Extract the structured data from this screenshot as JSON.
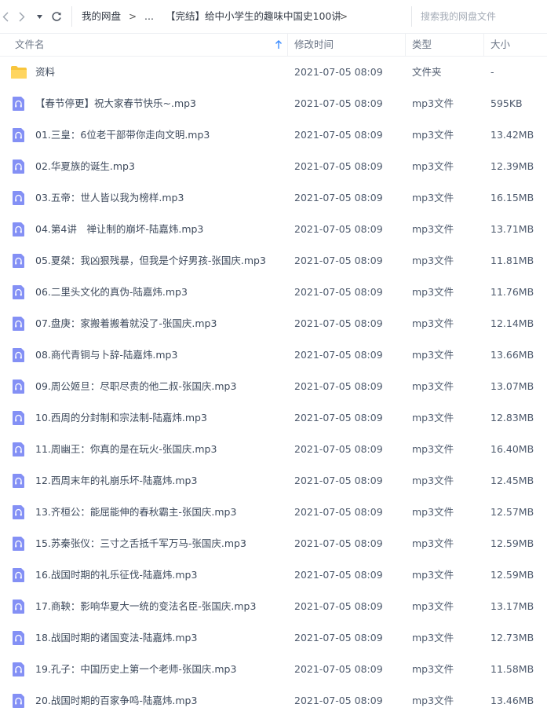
{
  "breadcrumb": {
    "root": "我的网盘",
    "ellipsis": "...",
    "current": "【完结】给中小学生的趣味中国史100讲",
    "arrow": ">"
  },
  "search": {
    "placeholder": "搜索我的网盘文件"
  },
  "columns": {
    "name": "文件名",
    "time": "修改时间",
    "type": "类型",
    "size": "大小"
  },
  "colors": {
    "folder": "#f8c53c",
    "audio_icon_bg": "#8490f5",
    "accent": "#3b8cff"
  },
  "files": [
    {
      "icon": "folder-icon",
      "name": "资料",
      "time": "2021-07-05 08:09",
      "type": "文件夹",
      "size": "-"
    },
    {
      "icon": "audio-file-icon",
      "name": "【春节停更】祝大家春节快乐~.mp3",
      "time": "2021-07-05 08:09",
      "type": "mp3文件",
      "size": "595KB"
    },
    {
      "icon": "audio-file-icon",
      "name": "01.三皇：6位老干部带你走向文明.mp3",
      "time": "2021-07-05 08:09",
      "type": "mp3文件",
      "size": "13.42MB"
    },
    {
      "icon": "audio-file-icon",
      "name": "02.华夏族的诞生.mp3",
      "time": "2021-07-05 08:09",
      "type": "mp3文件",
      "size": "12.39MB"
    },
    {
      "icon": "audio-file-icon",
      "name": "03.五帝：世人皆以我为榜样.mp3",
      "time": "2021-07-05 08:09",
      "type": "mp3文件",
      "size": "16.15MB"
    },
    {
      "icon": "audio-file-icon",
      "name": "04.第4讲　禅让制的崩坏-陆嘉炜.mp3",
      "time": "2021-07-05 08:09",
      "type": "mp3文件",
      "size": "13.71MB"
    },
    {
      "icon": "audio-file-icon",
      "name": "05.夏桀：我凶狠残暴，但我是个好男孩-张国庆.mp3",
      "time": "2021-07-05 08:09",
      "type": "mp3文件",
      "size": "11.81MB"
    },
    {
      "icon": "audio-file-icon",
      "name": "06.二里头文化的真伪-陆嘉炜.mp3",
      "time": "2021-07-05 08:09",
      "type": "mp3文件",
      "size": "11.76MB"
    },
    {
      "icon": "audio-file-icon",
      "name": "07.盘庚：家搬着搬着就没了-张国庆.mp3",
      "time": "2021-07-05 08:09",
      "type": "mp3文件",
      "size": "12.14MB"
    },
    {
      "icon": "audio-file-icon",
      "name": "08.商代青铜与卜辞-陆嘉炜.mp3",
      "time": "2021-07-05 08:09",
      "type": "mp3文件",
      "size": "13.66MB"
    },
    {
      "icon": "audio-file-icon",
      "name": "09.周公姬旦：尽职尽责的他二叔-张国庆.mp3",
      "time": "2021-07-05 08:09",
      "type": "mp3文件",
      "size": "13.07MB"
    },
    {
      "icon": "audio-file-icon",
      "name": "10.西周的分封制和宗法制-陆嘉炜.mp3",
      "time": "2021-07-05 08:09",
      "type": "mp3文件",
      "size": "12.83MB"
    },
    {
      "icon": "audio-file-icon",
      "name": "11.周幽王：你真的是在玩火-张国庆.mp3",
      "time": "2021-07-05 08:09",
      "type": "mp3文件",
      "size": "16.40MB"
    },
    {
      "icon": "audio-file-icon",
      "name": "12.西周末年的礼崩乐坏-陆嘉炜.mp3",
      "time": "2021-07-05 08:09",
      "type": "mp3文件",
      "size": "12.45MB"
    },
    {
      "icon": "audio-file-icon",
      "name": "13.齐桓公：能屈能伸的春秋霸主-张国庆.mp3",
      "time": "2021-07-05 08:09",
      "type": "mp3文件",
      "size": "12.57MB"
    },
    {
      "icon": "audio-file-icon",
      "name": "15.苏秦张仪：三寸之舌抵千军万马-张国庆.mp3",
      "time": "2021-07-05 08:09",
      "type": "mp3文件",
      "size": "12.59MB"
    },
    {
      "icon": "audio-file-icon",
      "name": "16.战国时期的礼乐征伐-陆嘉炜.mp3",
      "time": "2021-07-05 08:09",
      "type": "mp3文件",
      "size": "12.59MB"
    },
    {
      "icon": "audio-file-icon",
      "name": "17.商鞅：影响华夏大一统的变法名臣-张国庆.mp3",
      "time": "2021-07-05 08:09",
      "type": "mp3文件",
      "size": "13.17MB"
    },
    {
      "icon": "audio-file-icon",
      "name": "18.战国时期的诸国变法-陆嘉炜.mp3",
      "time": "2021-07-05 08:09",
      "type": "mp3文件",
      "size": "12.73MB"
    },
    {
      "icon": "audio-file-icon",
      "name": "19.孔子：中国历史上第一个老师-张国庆.mp3",
      "time": "2021-07-05 08:09",
      "type": "mp3文件",
      "size": "11.58MB"
    },
    {
      "icon": "audio-file-icon",
      "name": "20.战国时期的百家争鸣-陆嘉炜.mp3",
      "time": "2021-07-05 08:09",
      "type": "mp3文件",
      "size": "13.46MB"
    }
  ]
}
